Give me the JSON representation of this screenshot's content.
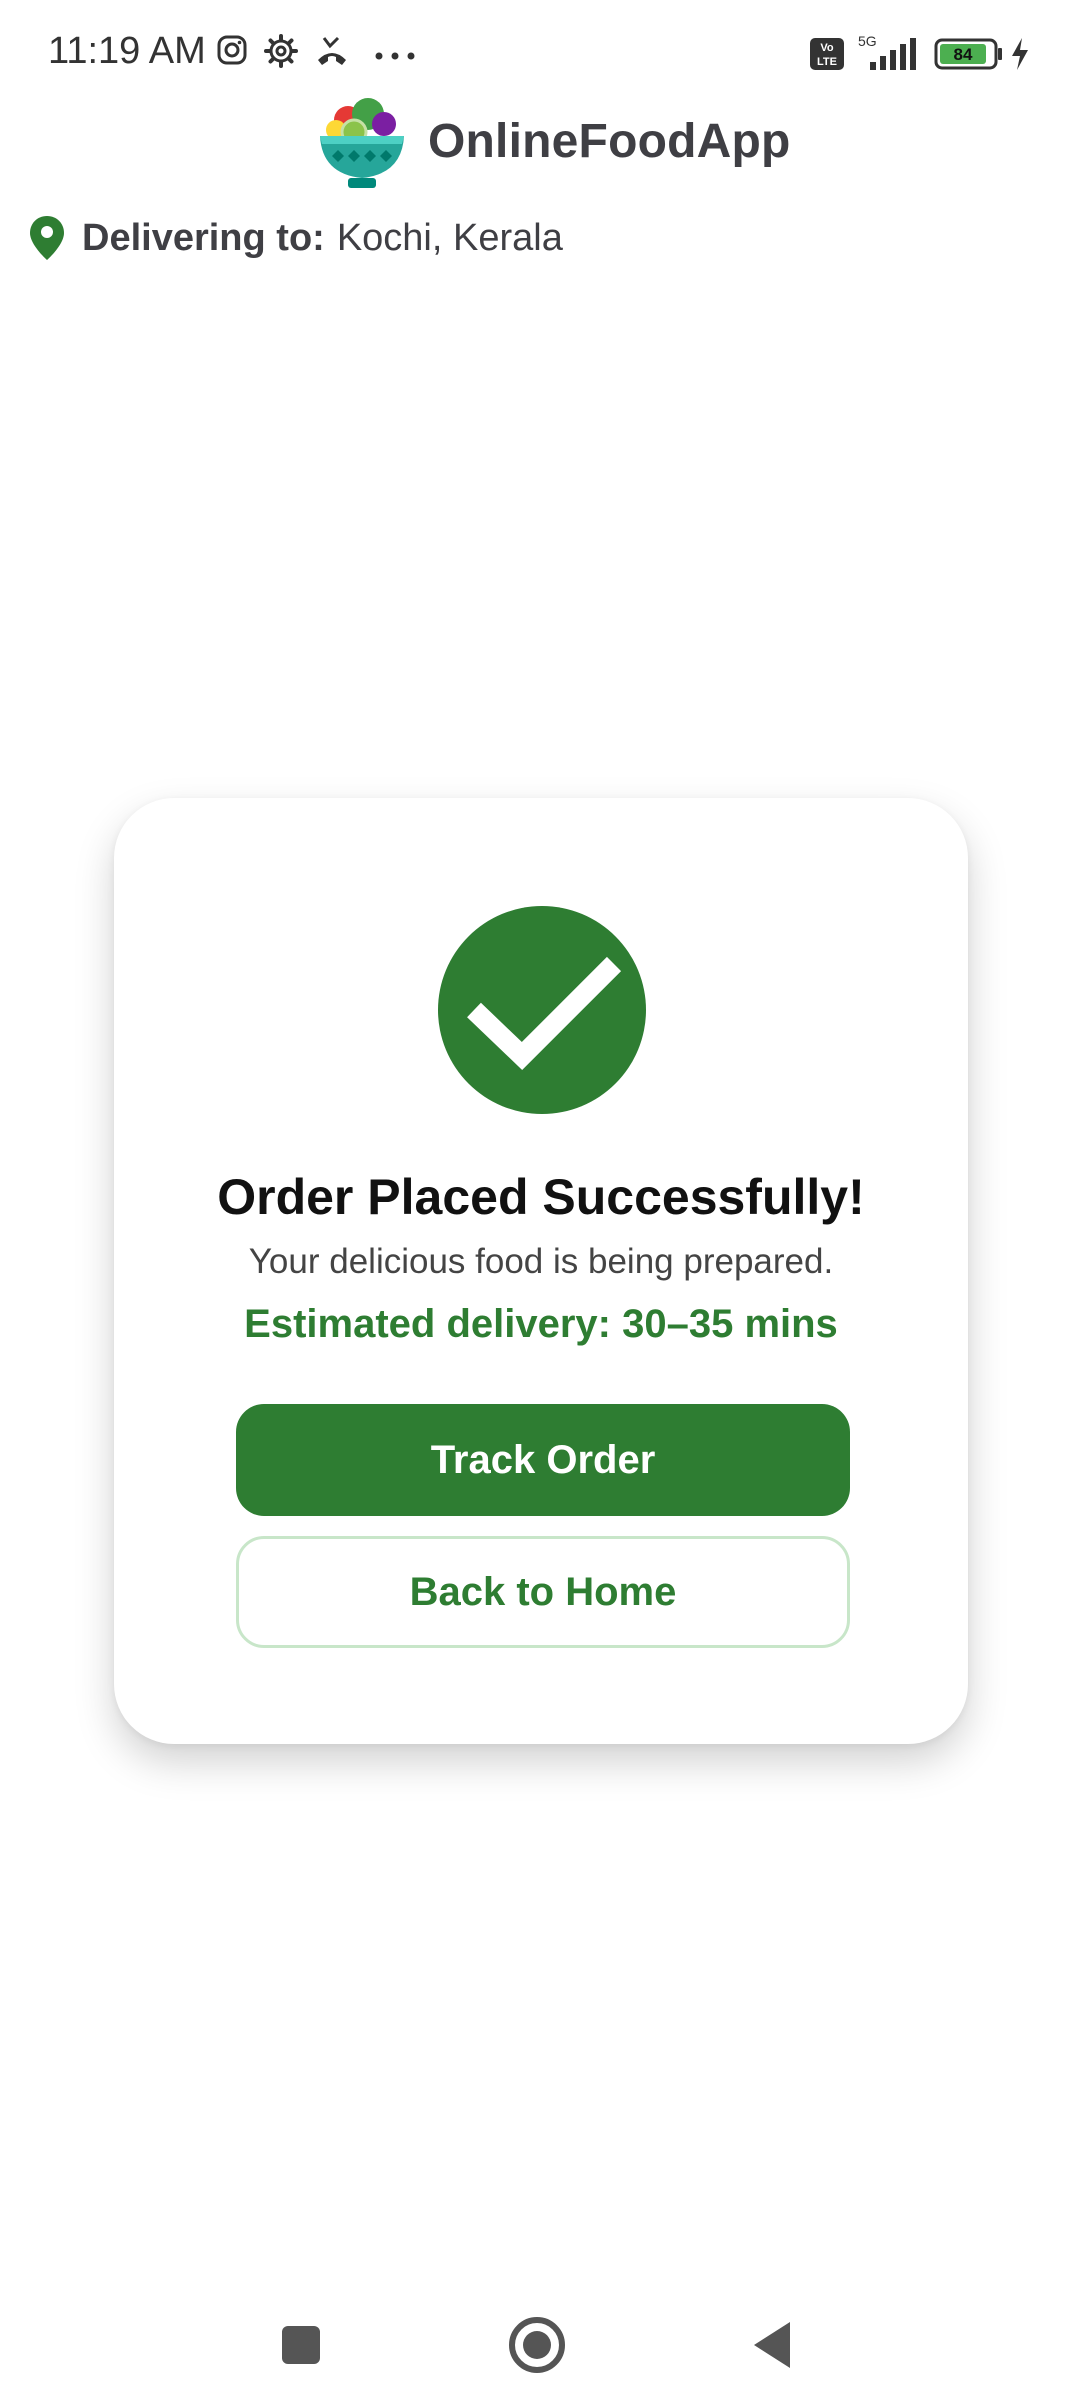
{
  "status_bar": {
    "time": "11:19 AM",
    "icons": [
      "instagram-icon",
      "settings-gear-icon",
      "missed-call-icon",
      "more-dots-icon",
      "volte-icon",
      "signal-5g-icon",
      "battery-icon",
      "charging-bolt-icon"
    ],
    "network": "5G",
    "volte_label": "Vo LTE",
    "battery": "84"
  },
  "header": {
    "app_name": "OnlineFoodApp"
  },
  "delivery": {
    "label": "Delivering to:",
    "location": "Kochi, Kerala"
  },
  "confirmation": {
    "title": "Order Placed Successfully!",
    "subtitle": "Your delicious food is being prepared.",
    "eta": "Estimated delivery: 30–35 mins",
    "primary_button": "Track Order",
    "secondary_button": "Back to Home"
  },
  "colors": {
    "accent": "#2e7d32",
    "card_bg": "#ffffff",
    "outline": "#c8e6c9",
    "battery_fill": "#4caf50"
  },
  "nav_bar": {
    "buttons": [
      "recents-square-icon",
      "home-circle-icon",
      "back-triangle-icon"
    ]
  }
}
